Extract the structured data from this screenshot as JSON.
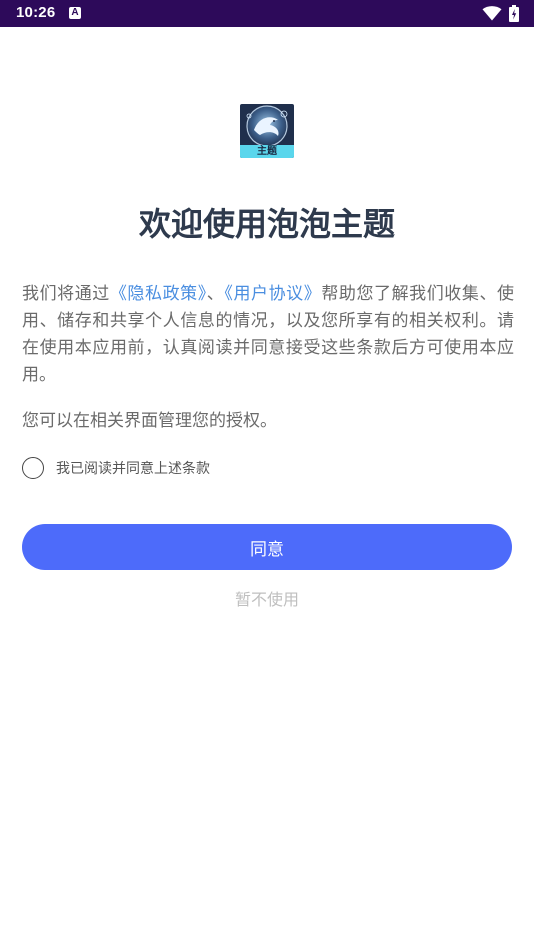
{
  "status_bar": {
    "time": "10:26",
    "notification_glyph": "A",
    "icons": [
      "notification-icon",
      "wifi-icon",
      "battery-icon"
    ]
  },
  "app": {
    "logo_icon": "app-logo-icon",
    "logo_label": "主题",
    "title": "欢迎使用泡泡主题"
  },
  "policy": {
    "text_part1": "我们将通过",
    "privacy_link": "《隐私政策》",
    "separator": "、",
    "user_agreement_link": "《用户协议》",
    "text_part2": "帮助您了解我们收集、使用、储存和共享个人信息的情况，以及您所享有的相关权利。请在使用本应用前，认真阅读并同意接受这些条款后方可使用本应用。",
    "manage_text": "您可以在相关界面管理您的授权。"
  },
  "consent": {
    "checkbox_label": "我已阅读并同意上述条款",
    "checked": false
  },
  "buttons": {
    "agree": "同意",
    "decline": "暂不使用"
  },
  "colors": {
    "status_bar": "#2d0a5a",
    "primary": "#4d6bfa",
    "link": "#4a8ee0",
    "title": "#2e3a4d",
    "body_text": "#6b6b6b",
    "muted": "#bfbfbf"
  }
}
